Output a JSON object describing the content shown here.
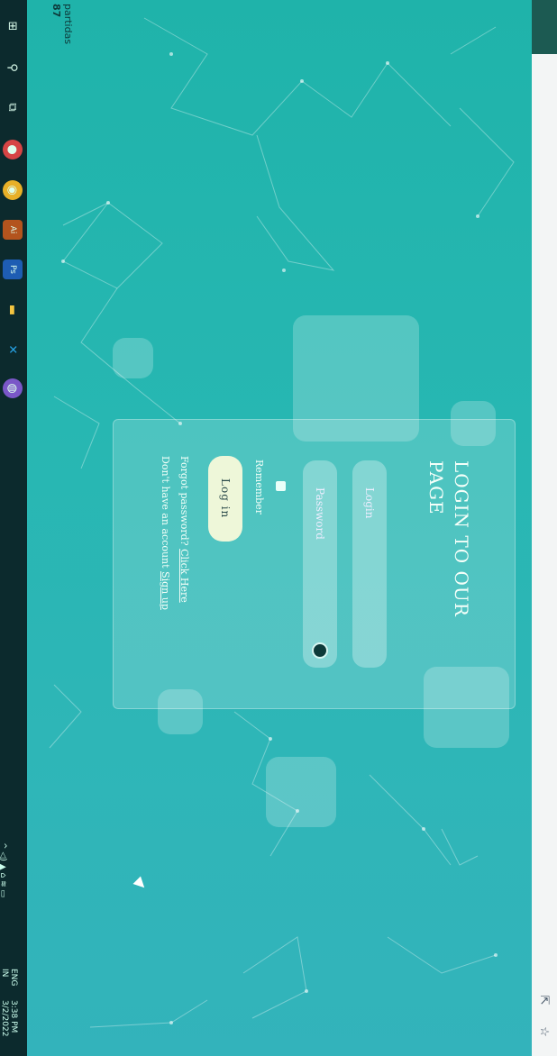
{
  "login": {
    "title_line1": "LOGIN TO OUR",
    "title_line2": "PAGE",
    "login_placeholder": "Login",
    "password_placeholder": "Password",
    "remember_label": "Remember",
    "login_button": "Log in",
    "forgot_text": "Forgot password?",
    "forgot_link": "Click Here",
    "signup_text": "Don't have an account",
    "signup_link": "Sign up"
  },
  "desktop": {
    "user_label": "partidas",
    "user_sub": "87"
  },
  "taskbar": {
    "lang": "ENG",
    "region": "IN",
    "time": "3:38 PM",
    "date": "3/2/2022",
    "tray_icons": "^ ◁) ▲ ⌂ ≋ ▭"
  },
  "colors": {
    "screen_top": "#1fb3aa",
    "screen_bottom": "#33b3bb",
    "button_bg": "#eef7d9",
    "taskbar": "#0c2a2d"
  }
}
